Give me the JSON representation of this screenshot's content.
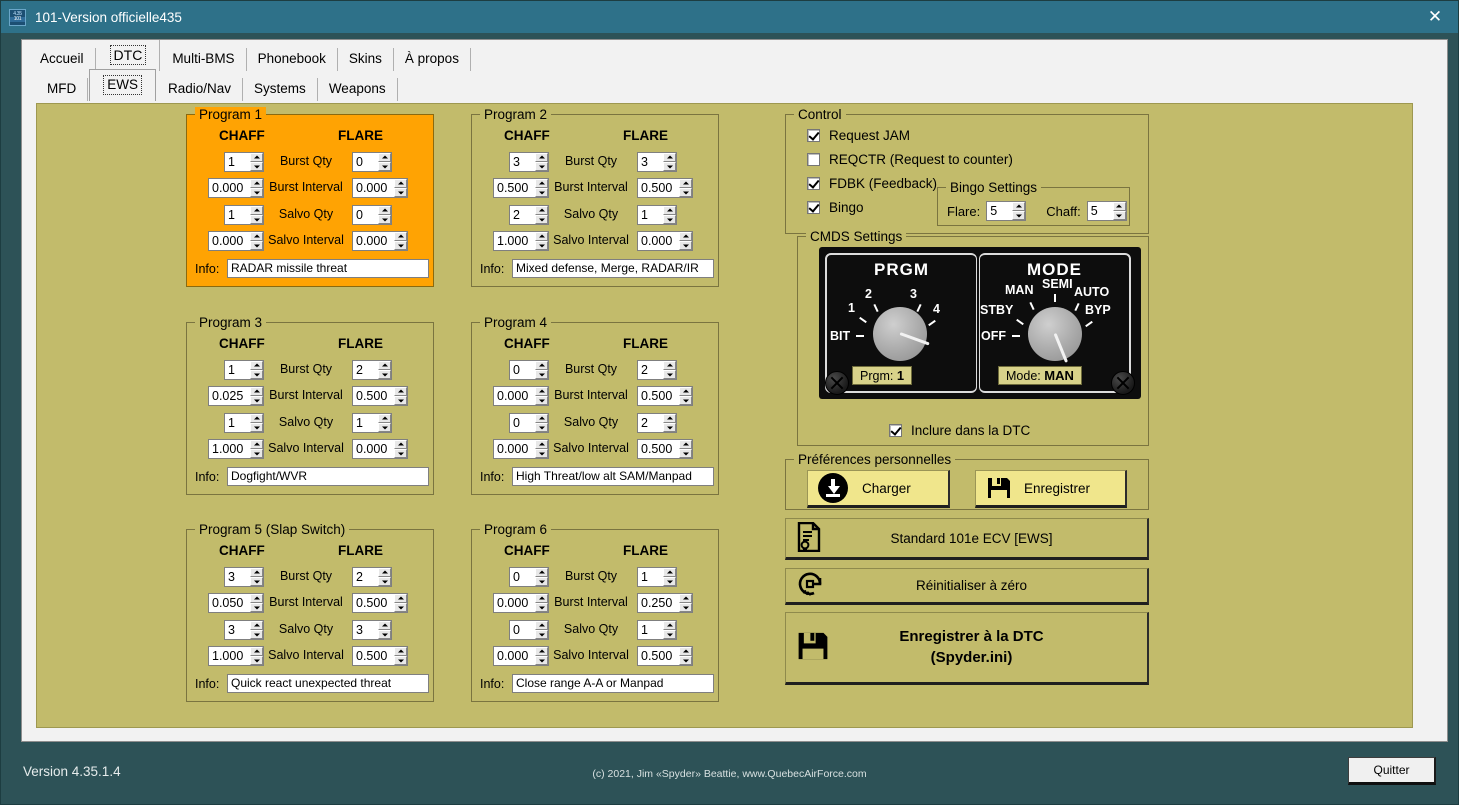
{
  "window": {
    "title": "101-Version officielle435",
    "icon_line1": "4.35",
    "icon_line2": "101",
    "close_glyph": "✕"
  },
  "outer_tabs": [
    {
      "label": "Accueil",
      "selected": false
    },
    {
      "label": "DTC",
      "selected": true
    },
    {
      "label": "Multi-BMS",
      "selected": false
    },
    {
      "label": "Phonebook",
      "selected": false
    },
    {
      "label": "Skins",
      "selected": false
    },
    {
      "label": "À propos",
      "selected": false
    }
  ],
  "inner_tabs": [
    {
      "label": "MFD",
      "selected": false
    },
    {
      "label": "EWS",
      "selected": true
    },
    {
      "label": "Radio/Nav",
      "selected": false
    },
    {
      "label": "Systems",
      "selected": false
    },
    {
      "label": "Weapons",
      "selected": false
    }
  ],
  "row_labels": [
    "Burst Qty",
    "Burst Interval",
    "Salvo Qty",
    "Salvo Interval"
  ],
  "column_headers": {
    "chaff": "CHAFF",
    "flare": "FLARE"
  },
  "info_label": "Info:",
  "programs": [
    {
      "title": "Program 1",
      "highlighted": true,
      "chaff": [
        "1",
        "0.000",
        "1",
        "0.000"
      ],
      "flare": [
        "0",
        "0.000",
        "0",
        "0.000"
      ],
      "info": "RADAR missile threat"
    },
    {
      "title": "Program 2",
      "highlighted": false,
      "chaff": [
        "3",
        "0.500",
        "2",
        "1.000"
      ],
      "flare": [
        "3",
        "0.500",
        "1",
        "0.000"
      ],
      "info": "Mixed defense, Merge, RADAR/IR"
    },
    {
      "title": "Program 3",
      "highlighted": false,
      "chaff": [
        "1",
        "0.025",
        "1",
        "1.000"
      ],
      "flare": [
        "2",
        "0.500",
        "1",
        "0.000"
      ],
      "info": "Dogfight/WVR"
    },
    {
      "title": "Program 4",
      "highlighted": false,
      "chaff": [
        "0",
        "0.000",
        "0",
        "0.000"
      ],
      "flare": [
        "2",
        "0.500",
        "2",
        "0.500"
      ],
      "info": "High Threat/low alt SAM/Manpad"
    },
    {
      "title": "Program 5 (Slap Switch)",
      "highlighted": false,
      "chaff": [
        "3",
        "0.050",
        "3",
        "1.000"
      ],
      "flare": [
        "2",
        "0.500",
        "3",
        "0.500"
      ],
      "info": "Quick react unexpected threat"
    },
    {
      "title": "Program 6",
      "highlighted": false,
      "chaff": [
        "0",
        "0.000",
        "0",
        "0.000"
      ],
      "flare": [
        "1",
        "0.250",
        "1",
        "0.500"
      ],
      "info": "Close range A-A or Manpad"
    }
  ],
  "control": {
    "title": "Control",
    "checkboxes": [
      {
        "label": "Request JAM",
        "checked": true
      },
      {
        "label": "REQCTR (Request to counter)",
        "checked": false
      },
      {
        "label": "FDBK (Feedback)",
        "checked": true
      },
      {
        "label": "Bingo",
        "checked": true
      }
    ]
  },
  "bingo": {
    "title": "Bingo Settings",
    "flare_label": "Flare:",
    "flare_value": "5",
    "chaff_label": "Chaff:",
    "chaff_value": "5"
  },
  "cmds": {
    "title": "CMDS Settings",
    "prgm_title": "PRGM",
    "mode_title": "MODE",
    "prgm_ticks": [
      "BIT",
      "1",
      "2",
      "3",
      "4"
    ],
    "mode_ticks": [
      "OFF",
      "STBY",
      "MAN",
      "SEMI",
      "AUTO",
      "BYP"
    ],
    "prgm_status_label": "Prgm:",
    "prgm_status_value": "1",
    "mode_status_label": "Mode:",
    "mode_status_value": "MAN",
    "include_checkbox": {
      "label": "Inclure dans la DTC",
      "checked": true
    }
  },
  "prefs": {
    "title": "Préférences personnelles",
    "load_label": "Charger",
    "save_label": "Enregistrer"
  },
  "actions": {
    "standard_label": "Standard 101e ECV [EWS]",
    "reset_label": "Réinitialiser à zéro",
    "save_dtc_line1": "Enregistrer à la DTC",
    "save_dtc_line2": "(Spyder.ini)"
  },
  "statusbar": {
    "version": "Version  4.35.1.4",
    "copyright": "(c) 2021, Jim «Spyder» Beattie, www.QuebecAirForce.com",
    "quit_label": "Quitter"
  },
  "colors": {
    "titlebar": "#2e7189",
    "window_bg": "#2d5257",
    "panel": "#c2bb6b",
    "highlight": "#FFA303",
    "pref_button": "#f0e68c",
    "cmds_face": "#0d0d0d"
  }
}
